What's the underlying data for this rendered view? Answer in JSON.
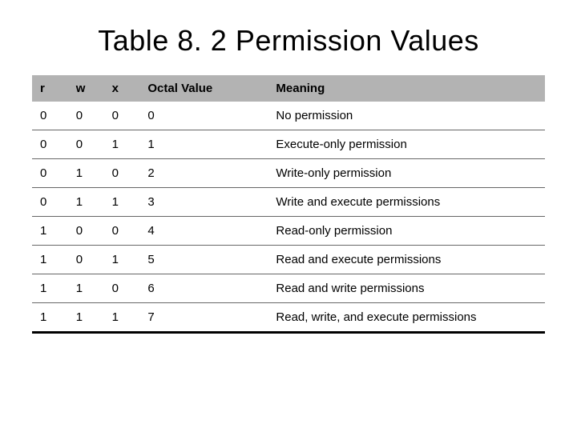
{
  "title": "Table 8. 2  Permission Values",
  "table": {
    "headers": {
      "r": "r",
      "w": "w",
      "x": "x",
      "octal": "Octal Value",
      "meaning": "Meaning"
    },
    "rows": [
      {
        "r": "0",
        "w": "0",
        "x": "0",
        "octal": "0",
        "meaning": "No permission"
      },
      {
        "r": "0",
        "w": "0",
        "x": "1",
        "octal": "1",
        "meaning": "Execute-only permission"
      },
      {
        "r": "0",
        "w": "1",
        "x": "0",
        "octal": "2",
        "meaning": "Write-only permission"
      },
      {
        "r": "0",
        "w": "1",
        "x": "1",
        "octal": "3",
        "meaning": "Write and execute permissions"
      },
      {
        "r": "1",
        "w": "0",
        "x": "0",
        "octal": "4",
        "meaning": "Read-only permission"
      },
      {
        "r": "1",
        "w": "0",
        "x": "1",
        "octal": "5",
        "meaning": "Read and execute permissions"
      },
      {
        "r": "1",
        "w": "1",
        "x": "0",
        "octal": "6",
        "meaning": "Read and write permissions"
      },
      {
        "r": "1",
        "w": "1",
        "x": "1",
        "octal": "7",
        "meaning": "Read, write, and execute permissions"
      }
    ]
  }
}
